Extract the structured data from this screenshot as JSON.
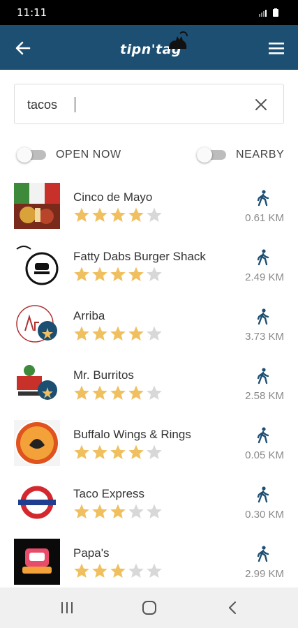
{
  "status": {
    "time": "11:11"
  },
  "app": {
    "logo_text": "tipn'tag"
  },
  "search": {
    "value": "tacos",
    "placeholder": ""
  },
  "filters": {
    "open_now_label": "OPEN NOW",
    "nearby_label": "NEARBY",
    "open_now_on": false,
    "nearby_on": false
  },
  "colors": {
    "app_bar": "#1d4f73",
    "star_filled": "#f0c060",
    "star_empty": "#d8d8d8",
    "icon": "#1d4f73",
    "distance": "#8a8a8a"
  },
  "results": [
    {
      "name": "Cinco de Mayo",
      "rating": 4,
      "distance": "0.61 KM",
      "icon": "walk-icon"
    },
    {
      "name": "Fatty Dabs Burger Shack",
      "rating": 4,
      "distance": "2.49 KM",
      "icon": "walk-icon"
    },
    {
      "name": "Arriba",
      "rating": 4,
      "distance": "3.73 KM",
      "icon": "walk-icon"
    },
    {
      "name": "Mr. Burritos",
      "rating": 4,
      "distance": "2.58 KM",
      "icon": "walk-icon"
    },
    {
      "name": "Buffalo Wings & Rings",
      "rating": 4,
      "distance": "0.05 KM",
      "icon": "walk-icon"
    },
    {
      "name": "Taco Express",
      "rating": 3,
      "distance": "0.30 KM",
      "icon": "walk-icon"
    },
    {
      "name": "Papa's",
      "rating": 3,
      "distance": "2.99 KM",
      "icon": "walk-icon"
    }
  ]
}
